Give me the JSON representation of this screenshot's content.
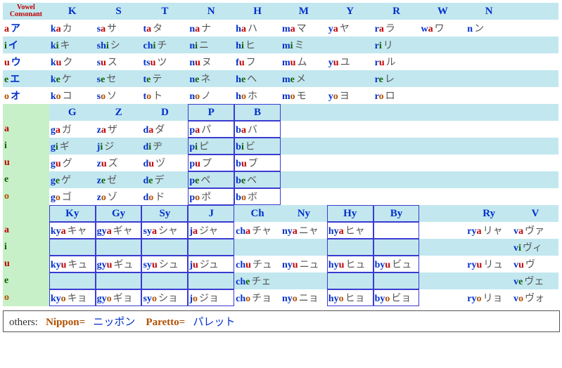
{
  "corner": "Vowel\nConsonant",
  "cols1": [
    "K",
    "S",
    "T",
    "N",
    "H",
    "M",
    "Y",
    "R",
    "W",
    "N"
  ],
  "vowels1": [
    {
      "v": "a",
      "k": "ア"
    },
    {
      "v": "i",
      "k": "イ"
    },
    {
      "v": "u",
      "k": "ウ"
    },
    {
      "v": "e",
      "k": "エ"
    },
    {
      "v": "o",
      "k": "オ"
    }
  ],
  "grid1": {
    "a": [
      [
        "k",
        "a",
        "カ"
      ],
      [
        "s",
        "a",
        "サ"
      ],
      [
        "t",
        "a",
        "タ"
      ],
      [
        "n",
        "a",
        "ナ"
      ],
      [
        "h",
        "a",
        "ハ"
      ],
      [
        "m",
        "a",
        "マ"
      ],
      [
        "y",
        "a",
        "ヤ"
      ],
      [
        "r",
        "a",
        "ラ"
      ],
      [
        "w",
        "a",
        "ワ"
      ],
      [
        "n",
        "",
        "ン"
      ]
    ],
    "i": [
      [
        "k",
        "i",
        "キ"
      ],
      [
        "sh",
        "i",
        "シ"
      ],
      [
        "ch",
        "i",
        "チ"
      ],
      [
        "n",
        "i",
        "ニ"
      ],
      [
        "h",
        "i",
        "ヒ"
      ],
      [
        "m",
        "i",
        "ミ"
      ],
      null,
      [
        "r",
        "i",
        "リ"
      ],
      null,
      null
    ],
    "u": [
      [
        "k",
        "u",
        "ク"
      ],
      [
        "s",
        "u",
        "ス"
      ],
      [
        "ts",
        "u",
        "ツ"
      ],
      [
        "n",
        "u",
        "ヌ"
      ],
      [
        "f",
        "u",
        "フ"
      ],
      [
        "m",
        "u",
        "ム"
      ],
      [
        "y",
        "u",
        "ユ"
      ],
      [
        "r",
        "u",
        "ル"
      ],
      null,
      null
    ],
    "e": [
      [
        "k",
        "e",
        "ケ"
      ],
      [
        "s",
        "e",
        "セ"
      ],
      [
        "t",
        "e",
        "テ"
      ],
      [
        "n",
        "e",
        "ネ"
      ],
      [
        "h",
        "e",
        "ヘ"
      ],
      [
        "m",
        "e",
        "メ"
      ],
      null,
      [
        "r",
        "e",
        "レ"
      ],
      null,
      null
    ],
    "o": [
      [
        "k",
        "o",
        "コ"
      ],
      [
        "s",
        "o",
        "ソ"
      ],
      [
        "t",
        "o",
        "ト"
      ],
      [
        "n",
        "o",
        "ノ"
      ],
      [
        "h",
        "o",
        "ホ"
      ],
      [
        "m",
        "o",
        "モ"
      ],
      [
        "y",
        "o",
        "ヨ"
      ],
      [
        "r",
        "o",
        "ロ"
      ],
      null,
      null
    ]
  },
  "cols2": [
    "G",
    "Z",
    "D",
    "P",
    "B"
  ],
  "vowels2": [
    "a",
    "i",
    "u",
    "e",
    "o"
  ],
  "grid2": {
    "a": [
      [
        "g",
        "a",
        "ガ"
      ],
      [
        "z",
        "a",
        "ザ"
      ],
      [
        "d",
        "a",
        "ダ"
      ],
      [
        "p",
        "a",
        "パ"
      ],
      [
        "b",
        "a",
        "バ"
      ]
    ],
    "i": [
      [
        "g",
        "i",
        "ギ"
      ],
      [
        "j",
        "i",
        "ジ"
      ],
      [
        "d",
        "i",
        "ヂ"
      ],
      [
        "p",
        "i",
        "ピ"
      ],
      [
        "b",
        "i",
        "ビ"
      ]
    ],
    "u": [
      [
        "g",
        "u",
        "グ"
      ],
      [
        "z",
        "u",
        "ズ"
      ],
      [
        "d",
        "u",
        "ヅ"
      ],
      [
        "p",
        "u",
        "プ"
      ],
      [
        "b",
        "u",
        "ブ"
      ]
    ],
    "e": [
      [
        "g",
        "e",
        "ゲ"
      ],
      [
        "z",
        "e",
        "ゼ"
      ],
      [
        "d",
        "e",
        "デ"
      ],
      [
        "p",
        "e",
        "ペ"
      ],
      [
        "b",
        "e",
        "ベ"
      ]
    ],
    "o": [
      [
        "g",
        "o",
        "ゴ"
      ],
      [
        "z",
        "o",
        "ゾ"
      ],
      [
        "d",
        "o",
        "ド"
      ],
      [
        "p",
        "o",
        "ポ"
      ],
      [
        "b",
        "o",
        "ボ"
      ]
    ]
  },
  "cols3": [
    "Ky",
    "Gy",
    "Sy",
    "J",
    "Ch",
    "Ny",
    "Hy",
    "By",
    "",
    "Ry",
    "V"
  ],
  "vowels3": [
    "a",
    "i",
    "u",
    "e",
    "o"
  ],
  "grid3": {
    "a": [
      [
        "ky",
        "a",
        "キャ"
      ],
      [
        "gy",
        "a",
        "ギャ"
      ],
      [
        "sy",
        "a",
        "シャ"
      ],
      [
        "j",
        "a",
        "ジャ"
      ],
      [
        "ch",
        "a",
        "チャ"
      ],
      [
        "ny",
        "a",
        "ニャ"
      ],
      [
        "hy",
        "a",
        "ヒャ"
      ],
      null,
      null,
      [
        "ry",
        "a",
        "リャ"
      ],
      [
        "v",
        "a",
        "ヴァ"
      ]
    ],
    "i": [
      null,
      null,
      null,
      null,
      null,
      null,
      null,
      null,
      null,
      null,
      [
        "v",
        "i",
        "ヴィ"
      ]
    ],
    "u": [
      [
        "ky",
        "u",
        "キュ"
      ],
      [
        "gy",
        "u",
        "ギュ"
      ],
      [
        "sy",
        "u",
        "シュ"
      ],
      [
        "j",
        "u",
        "ジュ"
      ],
      [
        "ch",
        "u",
        "チュ"
      ],
      [
        "ny",
        "u",
        "ニュ"
      ],
      [
        "hy",
        "u",
        "ヒュ"
      ],
      [
        "by",
        "u",
        "ビュ"
      ],
      null,
      [
        "ry",
        "u",
        "リュ"
      ],
      [
        "v",
        "u",
        "ヴ"
      ]
    ],
    "e": [
      null,
      null,
      null,
      null,
      [
        "ch",
        "e",
        "チェ"
      ],
      null,
      null,
      null,
      null,
      null,
      [
        "v",
        "e",
        "ヴェ"
      ]
    ],
    "o": [
      [
        "ky",
        "o",
        "キョ"
      ],
      [
        "gy",
        "o",
        "ギョ"
      ],
      [
        "sy",
        "o",
        "ショ"
      ],
      [
        "j",
        "o",
        "ジョ"
      ],
      [
        "ch",
        "o",
        "チョ"
      ],
      [
        "ny",
        "o",
        "ニョ"
      ],
      [
        "hy",
        "o",
        "ヒョ"
      ],
      [
        "by",
        "o",
        "ビョ"
      ],
      null,
      [
        "ry",
        "o",
        "リョ"
      ],
      [
        "v",
        "o",
        "ヴォ"
      ]
    ]
  },
  "box2_cols": [
    3,
    4
  ],
  "box3_groups": [
    [
      0,
      1
    ],
    [
      2,
      3
    ],
    [
      6,
      7
    ]
  ],
  "others": {
    "label": "others:",
    "items": [
      {
        "rom": "Nippon=",
        "kana": "ニッポン"
      },
      {
        "rom": "Paretto=",
        "kana": "パレット"
      }
    ]
  }
}
